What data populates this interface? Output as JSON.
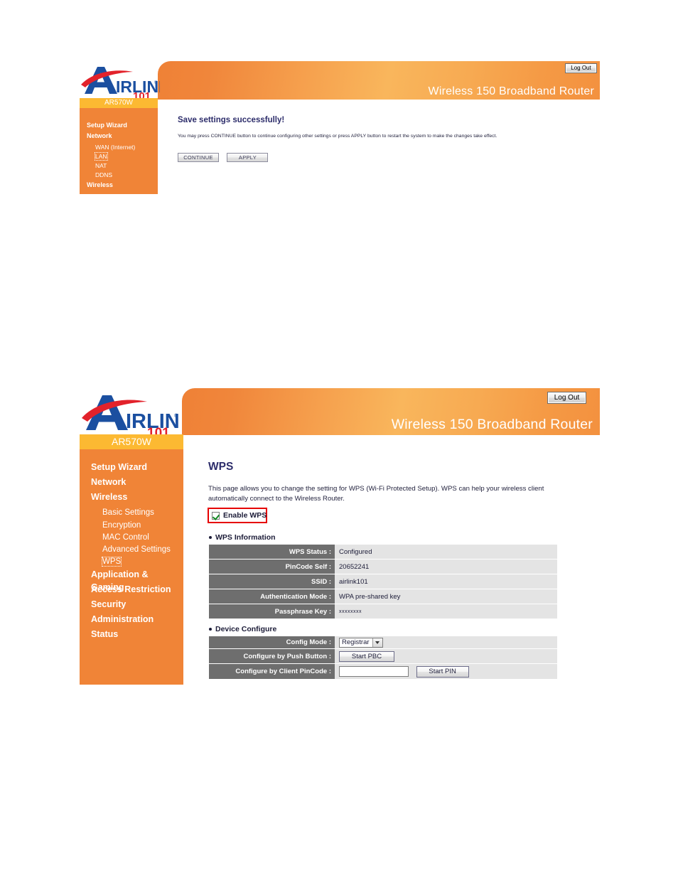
{
  "brand": {
    "logo_text_a": "A",
    "logo_text_main": "IRLINK",
    "logo_reg": "®",
    "logo_101": "101",
    "model": "AR570W"
  },
  "panel_one": {
    "header": {
      "title": "Wireless 150 Broadband Router",
      "logout_label": "Log Out"
    },
    "sidebar": {
      "model": "AR570W",
      "items": [
        {
          "label": "Setup Wizard",
          "level": "top",
          "selected": false
        },
        {
          "label": "Network",
          "level": "top",
          "selected": false
        },
        {
          "label": "WAN (Internet)",
          "level": "sub",
          "selected": false
        },
        {
          "label": "LAN",
          "level": "sub",
          "selected": true
        },
        {
          "label": "NAT",
          "level": "sub",
          "selected": false
        },
        {
          "label": "DDNS",
          "level": "sub",
          "selected": false
        },
        {
          "label": "Wireless",
          "level": "top",
          "selected": false
        }
      ]
    },
    "content": {
      "heading": "Save settings successfully!",
      "description": "You may press CONTINUE button to continue configuring other settings or press APPLY button to restart the system to make the changes take effect.",
      "continue_label": "CONTINUE",
      "apply_label": "APPLY"
    }
  },
  "panel_two": {
    "header": {
      "title": "Wireless 150 Broadband Router",
      "logout_label": "Log Out"
    },
    "sidebar": {
      "model": "AR570W",
      "items": [
        {
          "label": "Setup Wizard",
          "level": "top",
          "selected": false
        },
        {
          "label": "Network",
          "level": "top",
          "selected": false
        },
        {
          "label": "Wireless",
          "level": "top",
          "selected": false
        },
        {
          "label": "Basic Settings",
          "level": "sub",
          "selected": false
        },
        {
          "label": "Encryption",
          "level": "sub",
          "selected": false
        },
        {
          "label": "MAC Control",
          "level": "sub",
          "selected": false
        },
        {
          "label": "Advanced Settings",
          "level": "sub",
          "selected": false
        },
        {
          "label": "WPS",
          "level": "sub",
          "selected": true
        },
        {
          "label": "Application & Gaming",
          "level": "top",
          "selected": false
        },
        {
          "label": "Access Restriction",
          "level": "top",
          "selected": false
        },
        {
          "label": "Security",
          "level": "top",
          "selected": false
        },
        {
          "label": "Administration",
          "level": "top",
          "selected": false
        },
        {
          "label": "Status",
          "level": "top",
          "selected": false
        }
      ]
    },
    "content": {
      "heading": "WPS",
      "description": "This page allows you to change the setting for WPS (Wi-Fi Protected Setup). WPS can help your wireless client automatically connect to the Wireless Router.",
      "enable_wps_label": "Enable WPS",
      "enable_wps_checked": true,
      "wps_information": {
        "title": "WPS Information",
        "rows": [
          {
            "label": "WPS Status :",
            "value": "Configured",
            "masked": false
          },
          {
            "label": "PinCode Self :",
            "value": "20652241",
            "masked": false
          },
          {
            "label": "SSID :",
            "value": "airlink101",
            "masked": false
          },
          {
            "label": "Authentication Mode :",
            "value": "WPA pre-shared key",
            "masked": false
          },
          {
            "label": "Passphrase Key :",
            "value": "xxxxxxxx",
            "masked": true
          }
        ]
      },
      "device_configure": {
        "title": "Device Configure",
        "config_mode_label": "Config Mode :",
        "config_mode_value": "Registrar",
        "push_button_label": "Configure by Push Button :",
        "push_button_btn": "Start PBC",
        "client_pincode_label": "Configure by Client PinCode :",
        "client_pincode_value": "",
        "client_pincode_btn": "Start PIN"
      }
    }
  },
  "colors": {
    "orange_sidebar": "#f08437",
    "model_bar": "#fcb932",
    "header_start": "#ef8136",
    "header_mid": "#f9b65c",
    "table_label_bg": "#6e6e6e",
    "table_value_bg": "#e4e4e4",
    "heading": "#2d2d6b",
    "annotation_red": "#e60000",
    "check_green": "#0f8a22"
  }
}
